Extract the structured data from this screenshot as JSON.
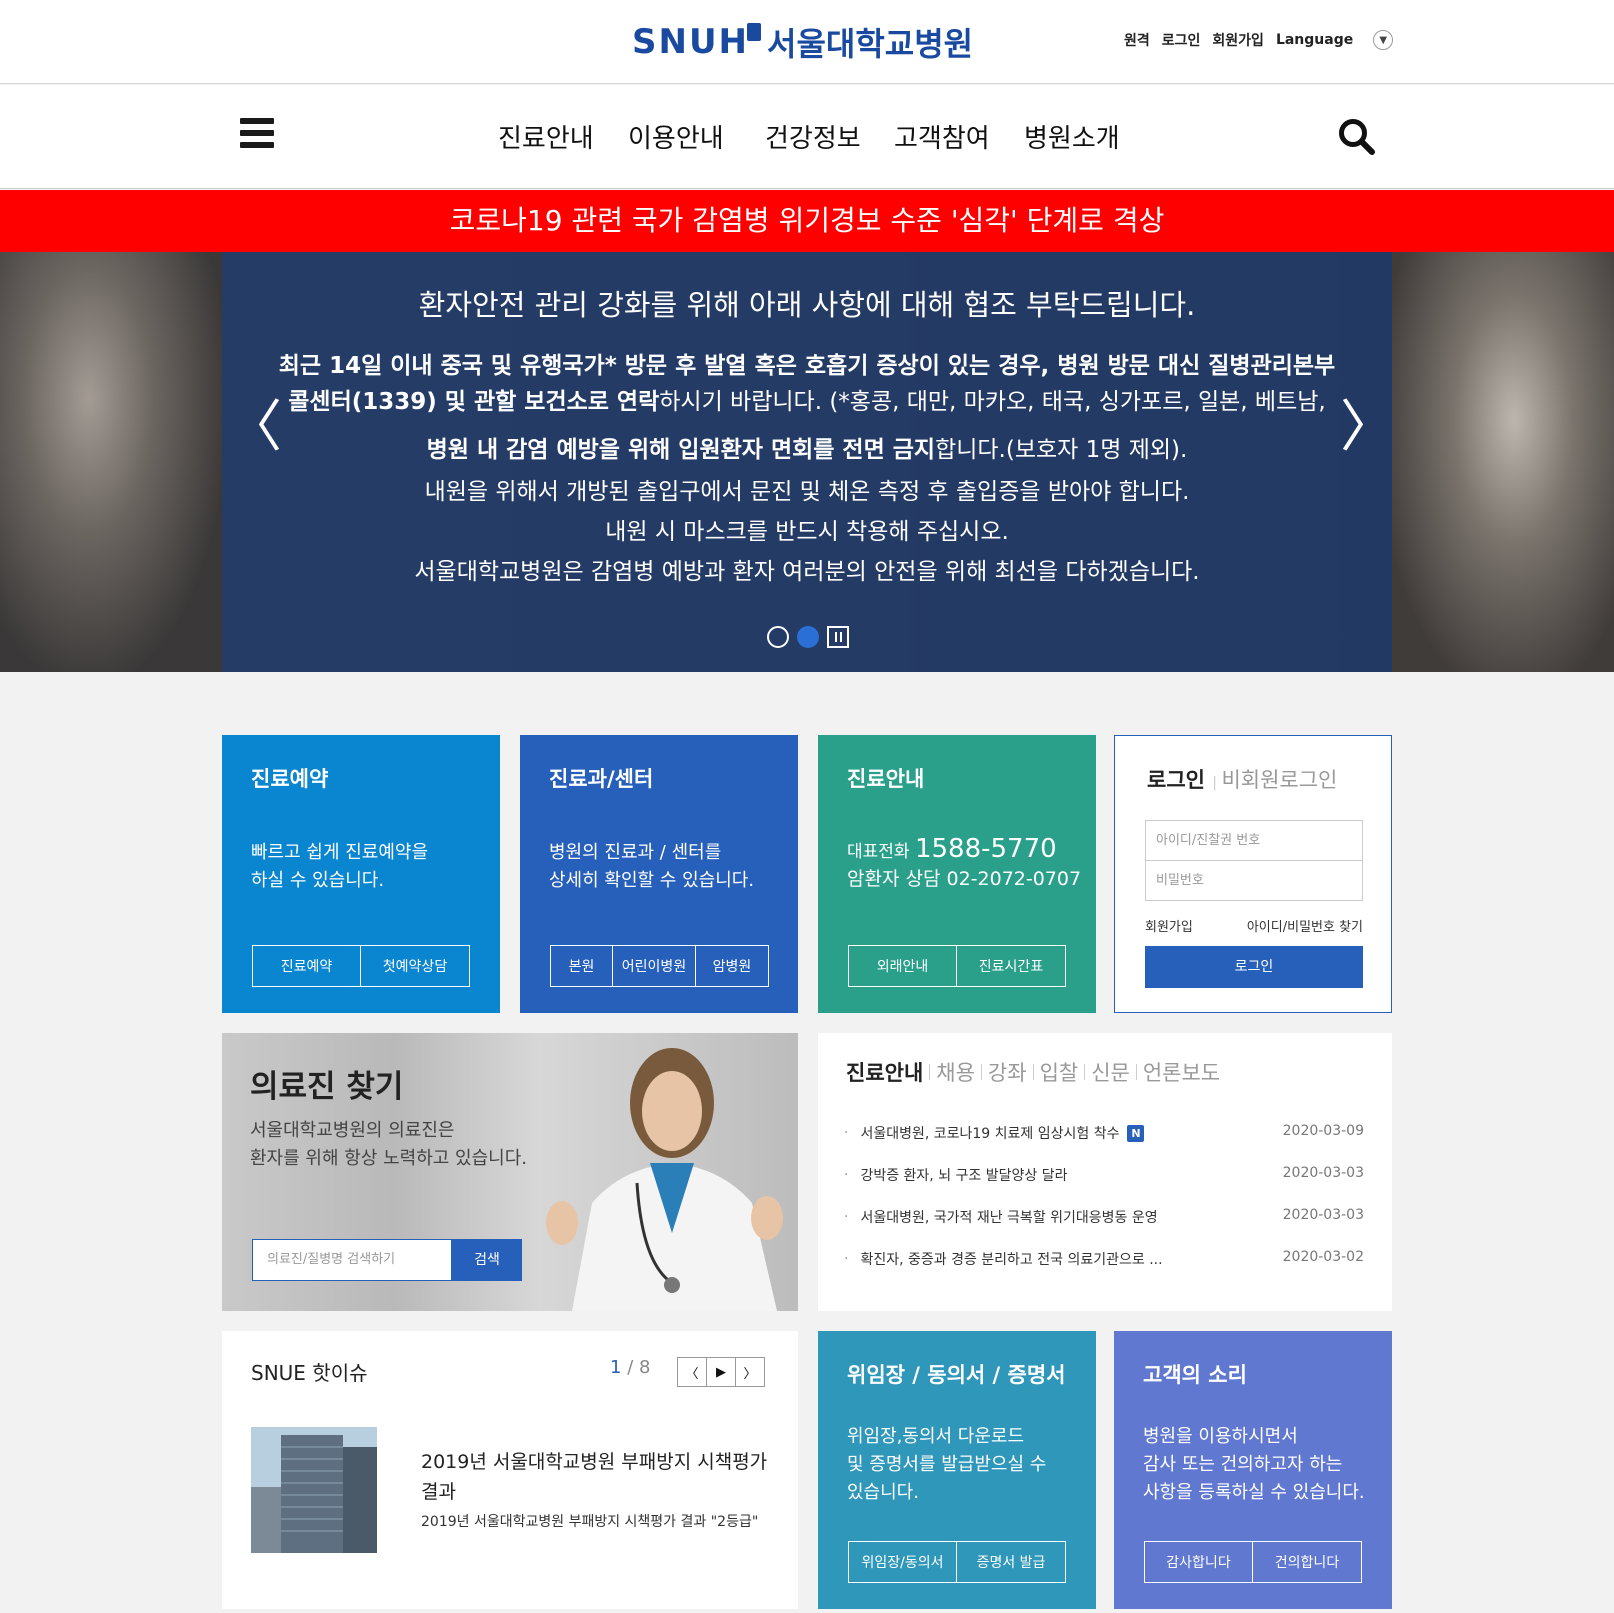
{
  "header": {
    "logo_en": "SNUH",
    "logo_kr": "서울대학교병원",
    "util": [
      "원격",
      "로그인",
      "회원가입",
      "Language"
    ]
  },
  "gnb": {
    "items": [
      "진료안내",
      "이용안내",
      "건강정보",
      "고객참여",
      "병원소개"
    ]
  },
  "alert": {
    "text": "코로나19 관련 국가 감염병 위기경보 수준 '심각' 단계로 격상"
  },
  "hero": {
    "title": "환자안전 관리 강화를 위해 아래 사항에 대해 협조 부탁드립니다.",
    "line1_bold": "최근 14일 이내 중국 및 유행국가* 방문 후 발열 혹은 호흡기 증상이 있는 경우, 병원 방문 대신 질병관리본부",
    "line2_bold": "콜센터(1339) 및 관할 보건소로 연락",
    "line2_rest": "하시기 바랍니다. (*홍콩, 대만, 마카오, 태국, 싱가포르, 일본, 베트남,",
    "line3_bold": "병원 내 감염 예방을 위해 입원환자 면회를 전면 금지",
    "line3_rest": "합니다.(보호자 1명 제외).",
    "line4": "내원을 위해서 개방된 출입구에서 문진 및 체온 측정 후 출입증을 받아야 합니다.",
    "line5": "내원 시 마스크를 반드시 착용해 주십시오.",
    "line6": "서울대학교병원은 감염병 예방과 환자 여러분의 안전을 위해 최선을 다하겠습니다.",
    "prev": "〈",
    "next": "〉"
  },
  "cards": {
    "reserve": {
      "title": "진료예약",
      "desc1": "빠르고 쉽게 진료예약을",
      "desc2": "하실 수 있습니다.",
      "btn1": "진료예약",
      "btn2": "첫예약상담"
    },
    "dept": {
      "title": "진료과/센터",
      "desc1": "병원의 진료과 / 센터를",
      "desc2": "상세히 확인할 수 있습니다.",
      "btn1": "본원",
      "btn2": "어린이병원",
      "btn3": "암병원"
    },
    "guide": {
      "title": "진료안내",
      "phone_label": "대표전화",
      "phone": "1588-5770",
      "cancer": "암환자 상담 02-2072-0707",
      "btn1": "외래안내",
      "btn2": "진료시간표"
    },
    "login": {
      "title": "로그인",
      "sub": "비회원로그인",
      "id_placeholder": "아이디/진찰권 번호",
      "pw_placeholder": "비밀번호",
      "join": "회원가입",
      "find": "아이디/비밀번호 찾기",
      "btn": "로그인"
    },
    "doctor": {
      "title": "의료진 찾기",
      "desc1": "서울대학교병원의 의료진은",
      "desc2": "환자를 위해 항상 노력하고 있습니다.",
      "placeholder": "의료진/질병명 검색하기",
      "btn": "검색"
    },
    "news": {
      "tabs": [
        "진료안내",
        "채용",
        "강좌",
        "입찰",
        "신문",
        "언론보도"
      ],
      "items": [
        {
          "title": "서울대병원, 코로나19 치료제 임상시험 착수",
          "new": "N",
          "date": "2020-03-09"
        },
        {
          "title": "강박증 환자, 뇌 구조 발달양상 달라",
          "date": "2020-03-03"
        },
        {
          "title": "서울대병원, 국가적 재난 극복할 위기대응병동 운영",
          "date": "2020-03-03"
        },
        {
          "title": "확진자, 중증과 경증 분리하고 전국 의료기관으로 ...",
          "date": "2020-03-02"
        }
      ]
    },
    "issue": {
      "title": "SNUE 핫이슈",
      "current": "1",
      "total": "/ 8",
      "headline": "2019년 서울대학교병원 부패방지 시책평가 결과",
      "body": "2019년 서울대학교병원 부패방지 시책평가 결과 \"2등급\""
    },
    "docs": {
      "title": "위임장 / 동의서 / 증명서",
      "desc1": "위임장,동의서 다운로드",
      "desc2": "및 증명서를 발급받으실 수",
      "desc3": "있습니다.",
      "btn1": "위임장/동의서",
      "btn2": "증명서 발급"
    },
    "voice": {
      "title": "고객의 소리",
      "desc1": "병원을 이용하시면서",
      "desc2": "감사 또는 건의하고자 하는",
      "desc3": "사항을 등록하실 수 있습니다.",
      "btn1": "감사합니다",
      "btn2": "건의합니다"
    }
  }
}
